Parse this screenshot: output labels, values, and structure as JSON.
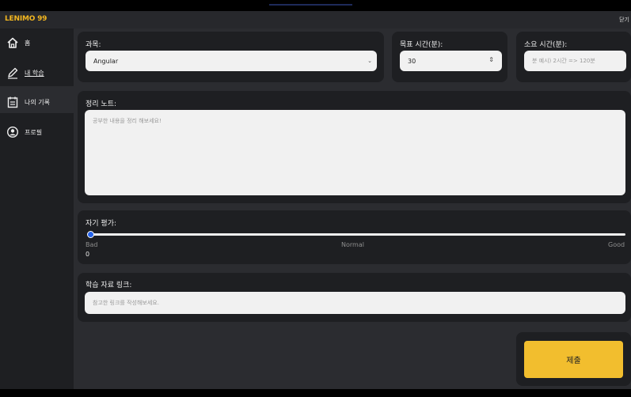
{
  "app": {
    "logo_text": "LENIMO",
    "logo_mark": "99",
    "close_label": "닫기",
    "accent_color": "#f2b620"
  },
  "sidebar": {
    "items": [
      {
        "label": "홈",
        "icon": "home-icon"
      },
      {
        "label": "내 학습",
        "icon": "pencil-icon",
        "active": true
      },
      {
        "label": "나의 기록",
        "icon": "calendar-icon"
      },
      {
        "label": "프로필",
        "icon": "profile-icon"
      }
    ]
  },
  "form": {
    "subject": {
      "label": "과목:",
      "value": "Angular"
    },
    "target_time": {
      "label": "목표 시간(분):",
      "value": "30"
    },
    "spent_time": {
      "label": "소요 시간(분):",
      "placeholder": "분 예시) 2시간 => 120분"
    },
    "notes": {
      "label": "정리 노트:",
      "placeholder": "공부한 내용을 정리 해보세요!"
    },
    "self_eval": {
      "label": "자기 평가:",
      "min_label": "Bad",
      "mid_label": "Normal",
      "max_label": "Good",
      "value": "0"
    },
    "link": {
      "label": "학습 자료 링크:",
      "placeholder": "참고한 링크를 작성해보세요."
    },
    "submit_label": "제출"
  },
  "colors": {
    "submit_bg": "#f2be2e",
    "slider_thumb": "#2563eb"
  }
}
